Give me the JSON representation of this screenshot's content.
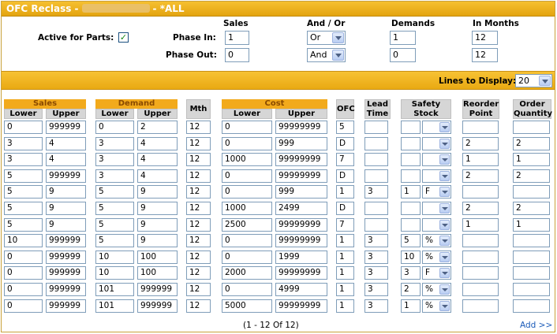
{
  "title": {
    "prefix": "OFC Reclass  -",
    "suffix": "- *ALL"
  },
  "form": {
    "col_sales": "Sales",
    "col_andor": "And / Or",
    "col_demands": "Demands",
    "col_months": "In Months",
    "active_label": "Active for Parts:",
    "active_checked": "✓",
    "phase_in_label": "Phase In:",
    "phase_out_label": "Phase Out:",
    "phase_in": {
      "sales": "1",
      "andor": "Or",
      "demands": "1",
      "months": "12"
    },
    "phase_out": {
      "sales": "0",
      "andor": "And",
      "demands": "0",
      "months": "12"
    }
  },
  "lines_to_display": {
    "label": "Lines to Display:",
    "value": "20"
  },
  "table": {
    "groups": {
      "sales": "Sales",
      "demand": "Demand",
      "cost": "Cost"
    },
    "sub": {
      "lower": "Lower",
      "upper": "Upper"
    },
    "mth": "Mth",
    "ofc": "OFC",
    "lead_time": [
      "Lead",
      "Time"
    ],
    "safety_stock": [
      "Safety",
      "Stock"
    ],
    "reorder_point": [
      "Reorder",
      "Point"
    ],
    "order_quantity": [
      "Order",
      "Quantity"
    ],
    "rows": [
      {
        "sl": "0",
        "su": "999999",
        "dl": "0",
        "du": "2",
        "m": "12",
        "cl": "0",
        "cu": "99999999",
        "ofc": "5",
        "lt": "",
        "ss": "",
        "st": "",
        "rp": "",
        "oq": ""
      },
      {
        "sl": "3",
        "su": "4",
        "dl": "3",
        "du": "4",
        "m": "12",
        "cl": "0",
        "cu": "999",
        "ofc": "D",
        "lt": "",
        "ss": "",
        "st": "",
        "rp": "2",
        "oq": "2"
      },
      {
        "sl": "3",
        "su": "4",
        "dl": "3",
        "du": "4",
        "m": "12",
        "cl": "1000",
        "cu": "99999999",
        "ofc": "7",
        "lt": "",
        "ss": "",
        "st": "",
        "rp": "1",
        "oq": "1"
      },
      {
        "sl": "5",
        "su": "999999",
        "dl": "3",
        "du": "4",
        "m": "12",
        "cl": "0",
        "cu": "99999999",
        "ofc": "D",
        "lt": "",
        "ss": "",
        "st": "",
        "rp": "2",
        "oq": "2"
      },
      {
        "sl": "5",
        "su": "9",
        "dl": "5",
        "du": "9",
        "m": "12",
        "cl": "0",
        "cu": "999",
        "ofc": "1",
        "lt": "3",
        "ss": "1",
        "st": "F",
        "rp": "",
        "oq": ""
      },
      {
        "sl": "5",
        "su": "9",
        "dl": "5",
        "du": "9",
        "m": "12",
        "cl": "1000",
        "cu": "2499",
        "ofc": "D",
        "lt": "",
        "ss": "",
        "st": "",
        "rp": "2",
        "oq": "2"
      },
      {
        "sl": "5",
        "su": "9",
        "dl": "5",
        "du": "9",
        "m": "12",
        "cl": "2500",
        "cu": "99999999",
        "ofc": "7",
        "lt": "",
        "ss": "",
        "st": "",
        "rp": "1",
        "oq": "1"
      },
      {
        "sl": "10",
        "su": "999999",
        "dl": "5",
        "du": "9",
        "m": "12",
        "cl": "0",
        "cu": "99999999",
        "ofc": "1",
        "lt": "3",
        "ss": "5",
        "st": "%",
        "rp": "",
        "oq": ""
      },
      {
        "sl": "0",
        "su": "999999",
        "dl": "10",
        "du": "100",
        "m": "12",
        "cl": "0",
        "cu": "1999",
        "ofc": "1",
        "lt": "3",
        "ss": "10",
        "st": "%",
        "rp": "",
        "oq": ""
      },
      {
        "sl": "0",
        "su": "999999",
        "dl": "10",
        "du": "100",
        "m": "12",
        "cl": "2000",
        "cu": "99999999",
        "ofc": "1",
        "lt": "3",
        "ss": "3",
        "st": "F",
        "rp": "",
        "oq": ""
      },
      {
        "sl": "0",
        "su": "999999",
        "dl": "101",
        "du": "999999",
        "m": "12",
        "cl": "0",
        "cu": "4999",
        "ofc": "1",
        "lt": "3",
        "ss": "2",
        "st": "%",
        "rp": "",
        "oq": ""
      },
      {
        "sl": "0",
        "su": "999999",
        "dl": "101",
        "du": "999999",
        "m": "12",
        "cl": "5000",
        "cu": "99999999",
        "ofc": "1",
        "lt": "3",
        "ss": "1",
        "st": "%",
        "rp": "",
        "oq": ""
      }
    ]
  },
  "footer": {
    "pager": "(1 - 12 Of 12)",
    "add": "Add >>"
  }
}
